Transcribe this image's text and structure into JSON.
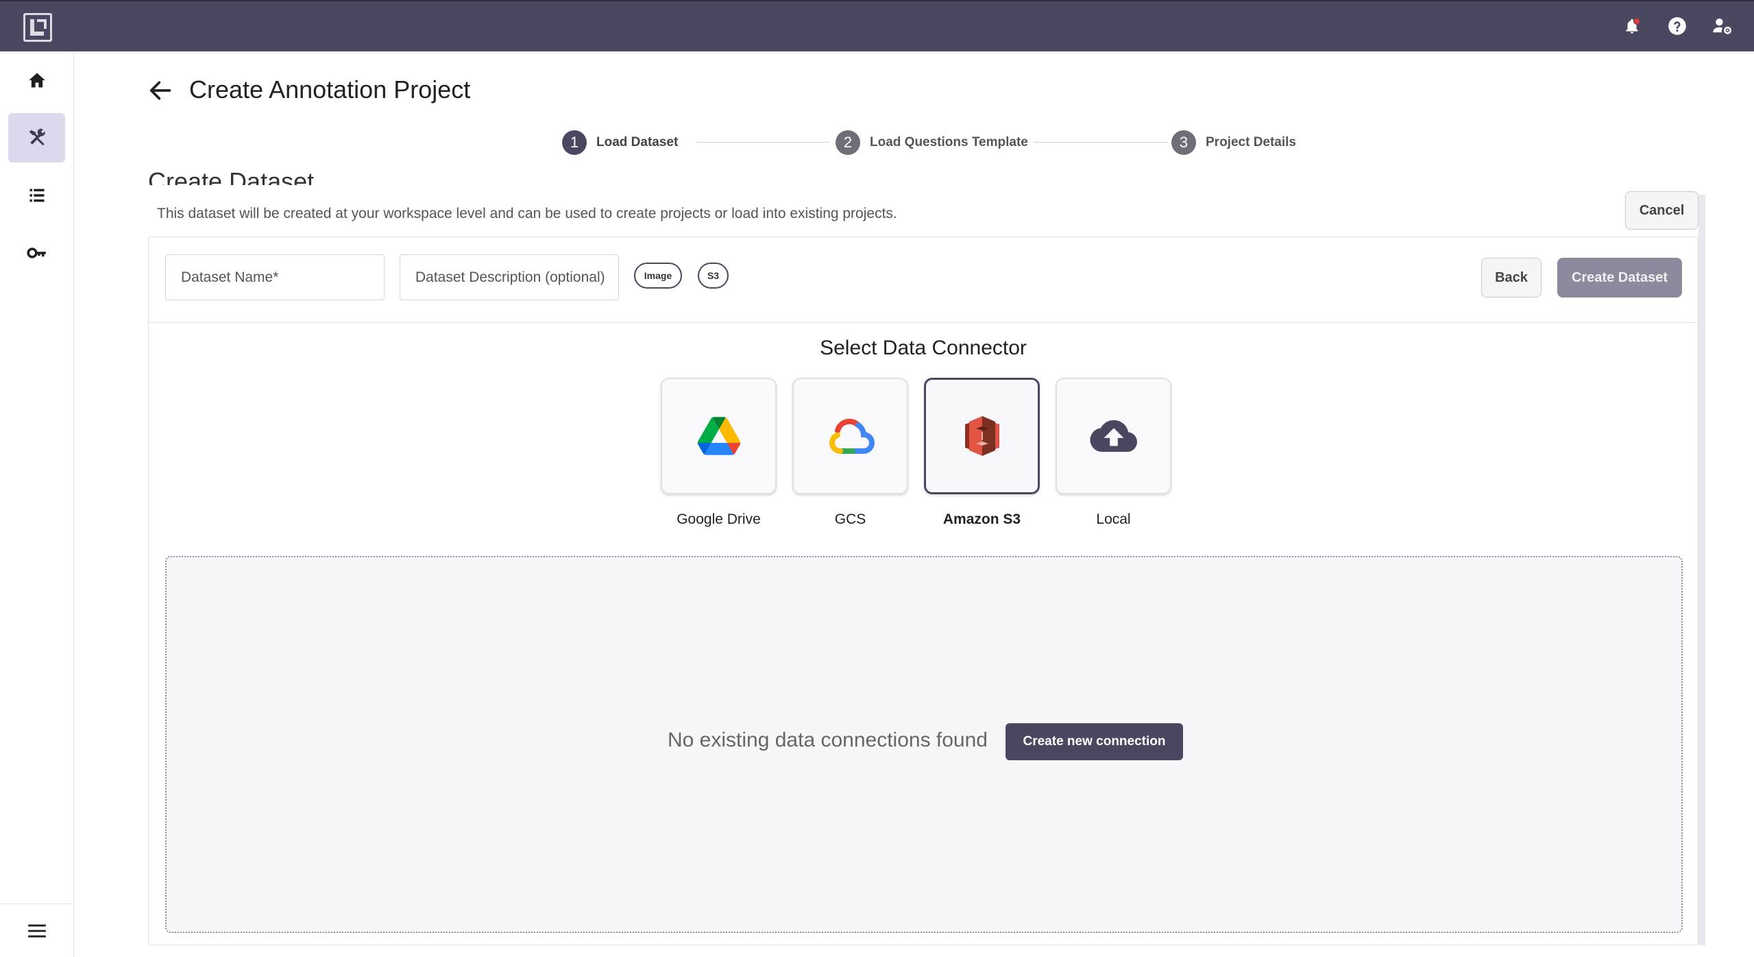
{
  "header": {
    "title": "Create Annotation Project"
  },
  "stepper": {
    "steps": [
      {
        "num": "1",
        "label": "Load Dataset"
      },
      {
        "num": "2",
        "label": "Load Questions Template"
      },
      {
        "num": "3",
        "label": "Project Details"
      }
    ]
  },
  "dataset": {
    "title": "Create Dataset",
    "description": "This dataset will be created at your workspace level and can be used to create projects or load into existing projects.",
    "cancel_label": "Cancel",
    "name_placeholder": "Dataset Name*",
    "description_placeholder": "Dataset Description (optional)",
    "chips": [
      "Image",
      "S3"
    ],
    "back_label": "Back",
    "create_label": "Create Dataset"
  },
  "connectors": {
    "title": "Select Data Connector",
    "items": [
      {
        "label": "Google Drive",
        "icon": "google-drive-icon"
      },
      {
        "label": "GCS",
        "icon": "gcs-icon"
      },
      {
        "label": "Amazon S3",
        "icon": "amazon-s3-icon",
        "selected": true
      },
      {
        "label": "Local",
        "icon": "cloud-upload-icon"
      }
    ]
  },
  "connections": {
    "empty_text": "No existing data connections found",
    "create_label": "Create new connection"
  },
  "colors": {
    "primary": "#4a4760",
    "disabled_button": "#8c8a9c",
    "notification_dot": "#e53935"
  }
}
